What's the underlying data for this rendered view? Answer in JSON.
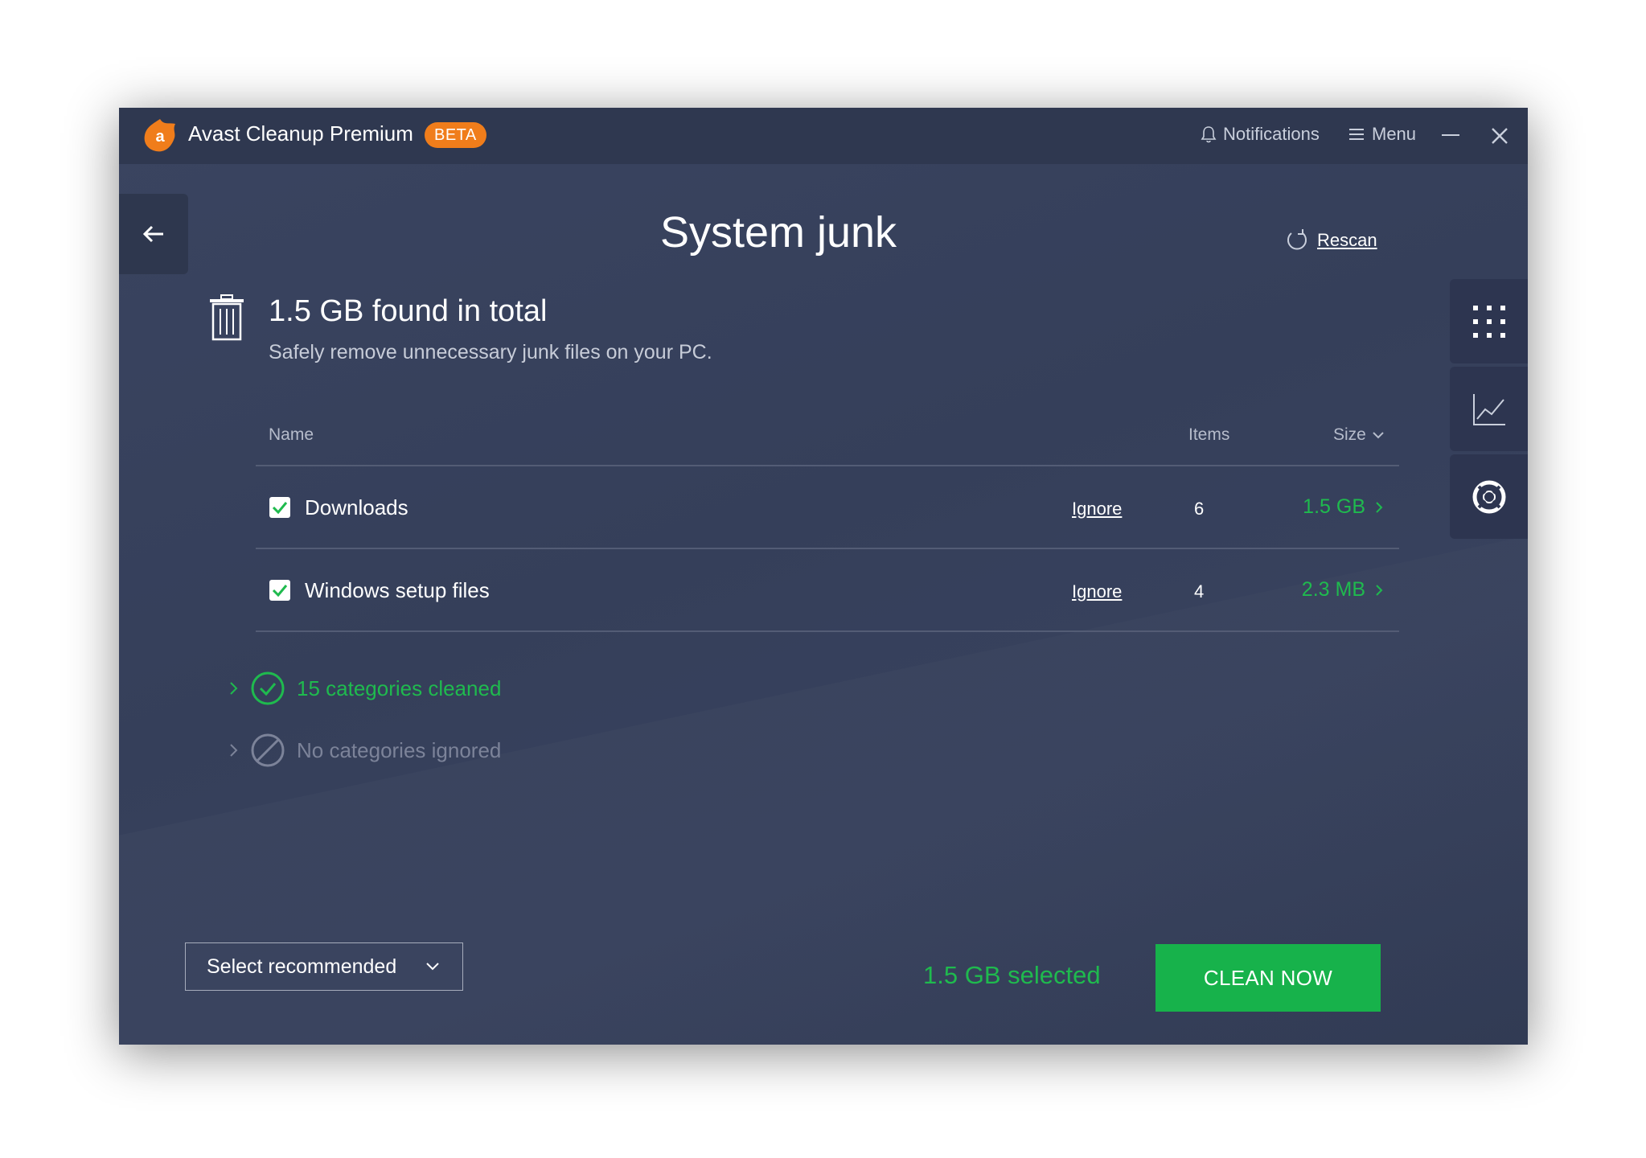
{
  "titlebar": {
    "app_name": "Avast Cleanup Premium",
    "badge": "BETA",
    "notifications_label": "Notifications",
    "menu_label": "Menu"
  },
  "page": {
    "title": "System junk",
    "rescan_label": "Rescan"
  },
  "summary": {
    "total": "1.5 GB found in total",
    "subtitle": "Safely remove unnecessary junk files on your PC."
  },
  "table": {
    "columns": {
      "name": "Name",
      "items": "Items",
      "size": "Size"
    },
    "rows": [
      {
        "name": "Downloads",
        "checked": true,
        "action": "Ignore",
        "items": "6",
        "size": "1.5 GB"
      },
      {
        "name": "Windows setup files",
        "checked": true,
        "action": "Ignore",
        "items": "4",
        "size": "2.3 MB"
      }
    ]
  },
  "categories": {
    "cleaned": "15 categories cleaned",
    "ignored": "No categories ignored"
  },
  "footer": {
    "select_label": "Select recommended",
    "selected_amount": "1.5 GB selected",
    "clean_button": "CLEAN NOW"
  },
  "colors": {
    "accent_green": "#1fba4e",
    "brand_orange": "#f07d1b",
    "window_bg": "#363f5b",
    "titlebar_bg": "#2f3850"
  },
  "icons": [
    "avast-logo-icon",
    "bell-icon",
    "hamburger-icon",
    "minimize-icon",
    "close-icon",
    "back-arrow-icon",
    "refresh-icon",
    "apps-grid-icon",
    "chart-icon",
    "support-icon",
    "trash-icon",
    "check-icon",
    "chevron-right-icon",
    "chevron-down-icon",
    "circle-check-icon",
    "circle-slash-icon"
  ]
}
